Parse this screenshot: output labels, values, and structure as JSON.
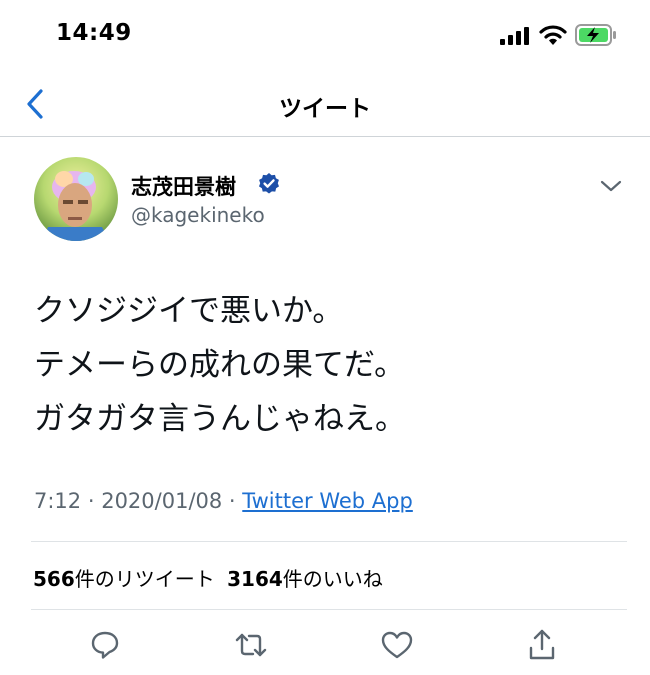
{
  "status_bar": {
    "time": "14:49"
  },
  "nav": {
    "title": "ツイート"
  },
  "author": {
    "name": "志茂田景樹",
    "handle": "@kagekineko"
  },
  "tweet": {
    "lines": [
      "クソジジイで悪いか。",
      "テメーらの成れの果てだ。",
      "ガタガタ言うんじゃねえ。"
    ],
    "time": "7:12",
    "date": "2020/01/08",
    "separator": " · ",
    "client": "Twitter Web App"
  },
  "stats": {
    "retweets": "566",
    "retweets_label": "件のリツイート",
    "likes": "3164",
    "likes_label": "件のいいね"
  },
  "colors": {
    "accent": "#1d6fd1",
    "verified": "#1d4fa8",
    "muted": "#5b6670",
    "battery": "#4cd964"
  },
  "icons": [
    "back-chevron-icon",
    "verified-badge-icon",
    "chevron-down-icon",
    "reply-icon",
    "retweet-icon",
    "like-icon",
    "share-icon"
  ]
}
